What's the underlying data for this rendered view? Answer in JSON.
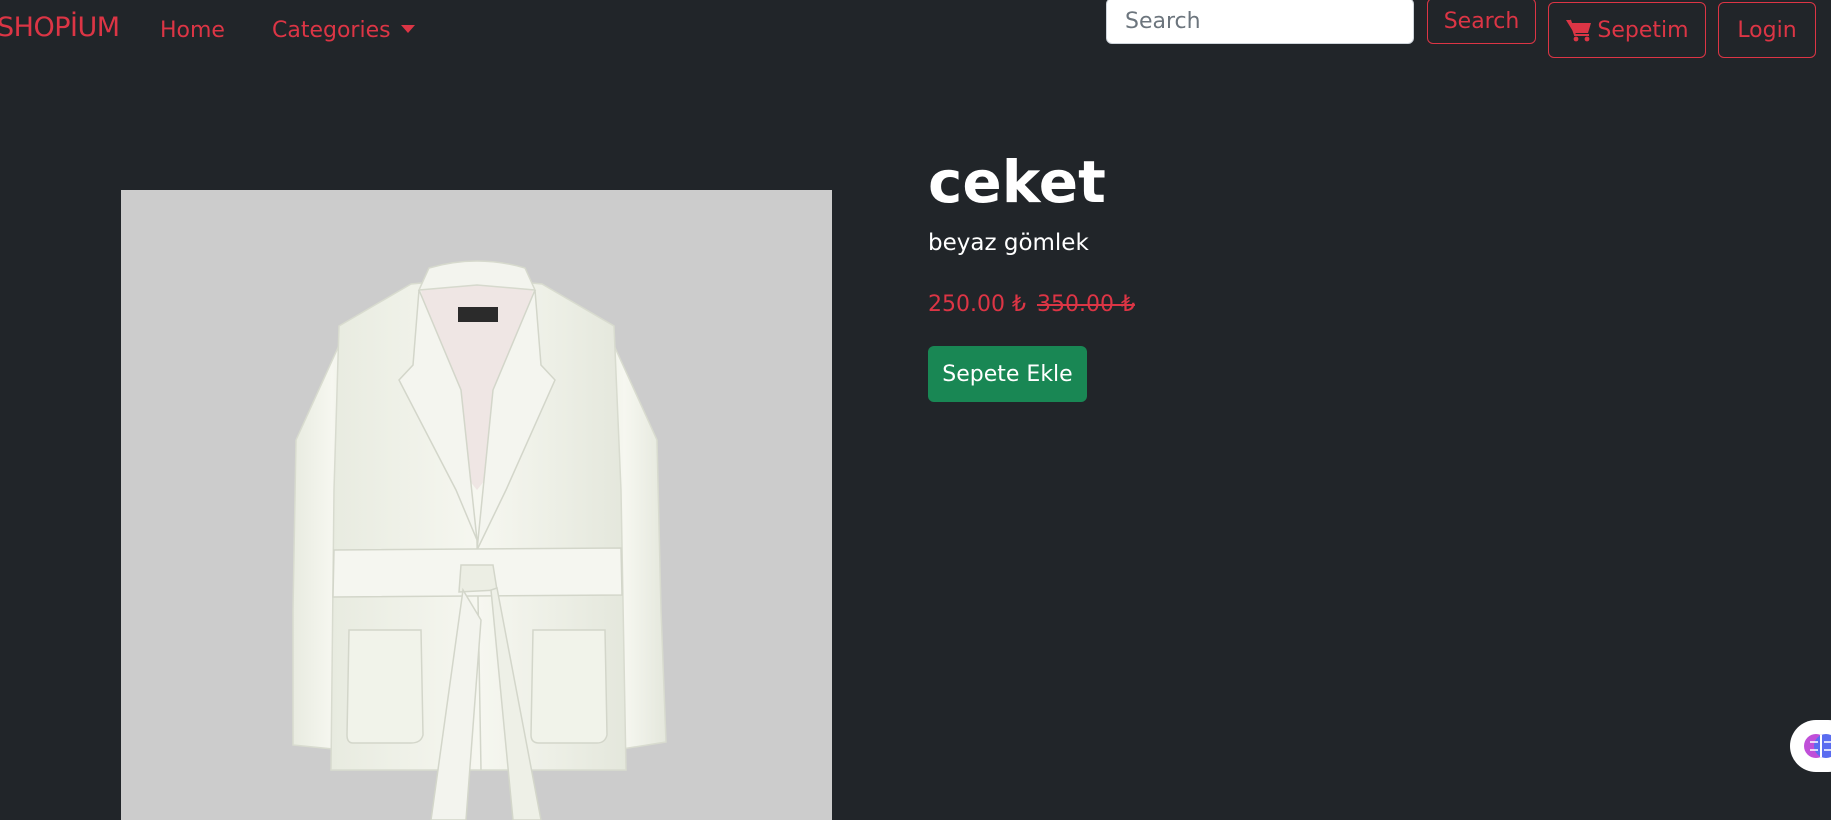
{
  "navbar": {
    "brand": "SHOPİUM",
    "links": {
      "home": "Home",
      "categories": "Categories"
    },
    "search": {
      "placeholder": "Search",
      "value": "",
      "button_label": "Search"
    },
    "cart_label": "Sepetim",
    "login_label": "Login"
  },
  "product": {
    "title": "ceket",
    "description": "beyaz gömlek",
    "price": "250.00 ₺",
    "old_price": "350.00 ₺",
    "add_to_cart_label": "Sepete Ekle"
  },
  "icons": {
    "cart": "cart-icon",
    "dropdown": "caret-down-icon",
    "widget": "brain-icon"
  },
  "colors": {
    "background": "#212529",
    "accent": "#dc3545",
    "success": "#198754",
    "image_bg": "#cccccc"
  }
}
